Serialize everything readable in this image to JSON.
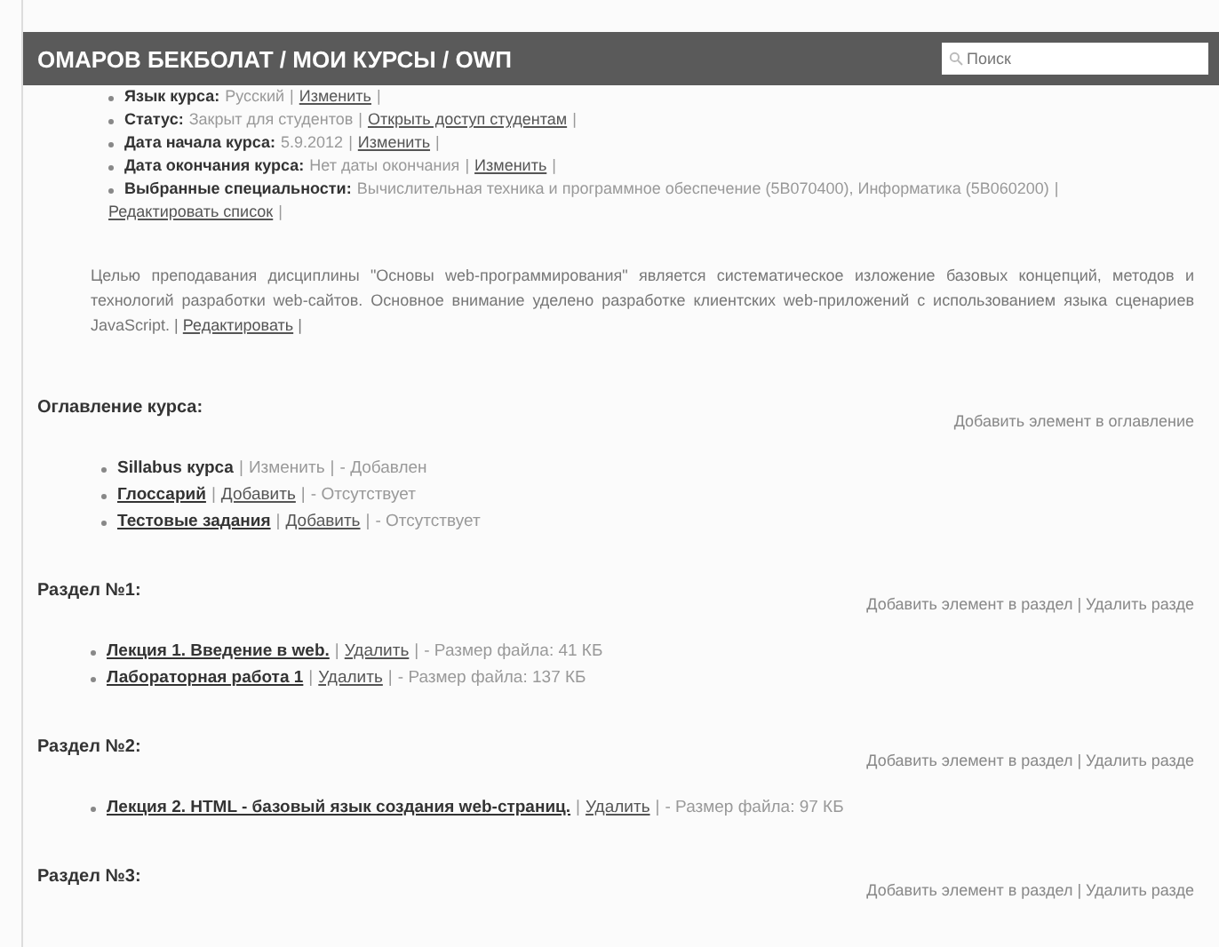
{
  "header": {
    "breadcrumb": "ОМАРОВ БЕКБОЛАТ / МОИ КУРСЫ / OWП",
    "search": {
      "placeholder": "Поиск"
    }
  },
  "course_info": [
    {
      "segments": [
        {
          "kind": "label",
          "text": "Язык курса:"
        },
        {
          "kind": "note",
          "text": "Русский"
        },
        {
          "kind": "sep",
          "text": "|"
        },
        {
          "kind": "link",
          "text": "Изменить"
        },
        {
          "kind": "sep",
          "text": "|"
        }
      ]
    },
    {
      "segments": [
        {
          "kind": "label",
          "text": "Статус:"
        },
        {
          "kind": "note",
          "text": "Закрыт для студентов"
        },
        {
          "kind": "sep",
          "text": "|"
        },
        {
          "kind": "link",
          "text": "Открыть доступ студентам"
        },
        {
          "kind": "sep",
          "text": "|"
        }
      ]
    },
    {
      "segments": [
        {
          "kind": "label",
          "text": "Дата начала курса:"
        },
        {
          "kind": "note",
          "text": "5.9.2012"
        },
        {
          "kind": "sep",
          "text": "|"
        },
        {
          "kind": "link",
          "text": "Изменить"
        },
        {
          "kind": "sep",
          "text": "|"
        }
      ]
    },
    {
      "segments": [
        {
          "kind": "label",
          "text": "Дата окончания курса:"
        },
        {
          "kind": "note",
          "text": "Нет даты окончания"
        },
        {
          "kind": "sep",
          "text": "|"
        },
        {
          "kind": "link",
          "text": "Изменить"
        },
        {
          "kind": "sep",
          "text": "|"
        }
      ]
    },
    {
      "segments": [
        {
          "kind": "label",
          "text": "Выбранные специальности:"
        },
        {
          "kind": "note",
          "text": "Вычислительная техника и программное обеспечение (5В070400), Информатика (5В060200)"
        },
        {
          "kind": "sep",
          "text": "|"
        },
        {
          "kind": "link",
          "text": "Редактировать список"
        },
        {
          "kind": "sep",
          "text": "|"
        }
      ]
    }
  ],
  "description": {
    "text": "Целью преподавания дисциплины \"Основы web-программирования\" является систематическое изложение базовых концепций, методов и технологий разработки web-сайтов. Основное внимание уделено разработке клиентских web-приложений с использованием языка сценариев JavaScript.",
    "edit_link": "Редактировать",
    "separators": [
      "|",
      "|"
    ]
  },
  "sections": [
    {
      "title": "Оглавление курса:",
      "actions": "Добавить элемент в оглавление",
      "items": [
        {
          "segments": [
            {
              "kind": "title",
              "text": "Sillabus курса"
            },
            {
              "kind": "sep",
              "text": "|"
            },
            {
              "kind": "note",
              "text": "Изменить"
            },
            {
              "kind": "sep",
              "text": "|"
            },
            {
              "kind": "note",
              "text": "- Добавлен"
            }
          ]
        },
        {
          "segments": [
            {
              "kind": "title-link",
              "text": "Глоссарий"
            },
            {
              "kind": "sep",
              "text": "|"
            },
            {
              "kind": "link",
              "text": "Добавить"
            },
            {
              "kind": "sep",
              "text": "|"
            },
            {
              "kind": "note",
              "text": "- Отсутствует"
            }
          ]
        },
        {
          "segments": [
            {
              "kind": "title-link",
              "text": "Тестовые задания"
            },
            {
              "kind": "sep",
              "text": "|"
            },
            {
              "kind": "link",
              "text": "Добавить"
            },
            {
              "kind": "sep",
              "text": "|"
            },
            {
              "kind": "note",
              "text": "- Отсутствует"
            }
          ]
        }
      ]
    },
    {
      "title": "Раздел №1:",
      "actions": "Добавить элемент в раздел | Удалить разде",
      "items": [
        {
          "segments": [
            {
              "kind": "title-link",
              "text": "Лекция 1. Введение в web."
            },
            {
              "kind": "sep",
              "text": "|"
            },
            {
              "kind": "link",
              "text": "Удалить"
            },
            {
              "kind": "sep",
              "text": "|"
            },
            {
              "kind": "note",
              "text": "- Размер файла: 41 КБ"
            }
          ]
        },
        {
          "segments": [
            {
              "kind": "title-link",
              "text": "Лабораторная работа 1"
            },
            {
              "kind": "sep",
              "text": "|"
            },
            {
              "kind": "link",
              "text": "Удалить"
            },
            {
              "kind": "sep",
              "text": "|"
            },
            {
              "kind": "note",
              "text": "- Размер файла: 137 КБ"
            }
          ]
        }
      ]
    },
    {
      "title": "Раздел №2:",
      "actions": "Добавить элемент в раздел | Удалить разде",
      "items": [
        {
          "segments": [
            {
              "kind": "title-link",
              "text": "Лекция 2. HTML - базовый язык создания web-страниц."
            },
            {
              "kind": "sep",
              "text": "|"
            },
            {
              "kind": "link",
              "text": "Удалить"
            },
            {
              "kind": "sep",
              "text": "|"
            },
            {
              "kind": "note",
              "text": "- Размер файла: 97 КБ"
            }
          ]
        }
      ]
    },
    {
      "title": "Раздел №3:",
      "actions": "Добавить элемент в раздел | Удалить разде"
    }
  ]
}
